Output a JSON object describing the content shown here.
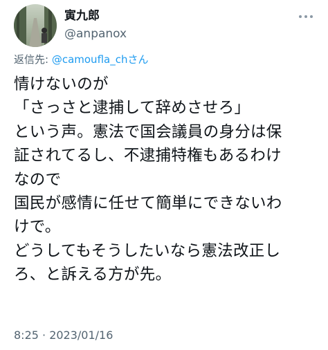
{
  "author": {
    "display_name": "寅九郎",
    "handle": "@anpanox"
  },
  "reply_context": {
    "prefix": "返信先: ",
    "mention": "@camoufla_ch",
    "suffix": "さん"
  },
  "tweet": {
    "lines": [
      "情けないのが",
      "「さっさと逮捕して辞めさせろ」",
      "という声。憲法で国会議員の身分は保",
      "証されてるし、不逮捕特権もあるわけ",
      "なので",
      "国民が感情に任せて簡単にできないわ",
      "けで。",
      "どうしてもそうしたいなら憲法改正し",
      "ろ、と訴える方が先。"
    ],
    "timestamp": "8:25 · 2023/01/16"
  },
  "colors": {
    "text": "#0f1419",
    "secondary": "#536471",
    "accent": "#1d9bf0"
  },
  "icons": {
    "more": "more-horizontal-icon"
  }
}
